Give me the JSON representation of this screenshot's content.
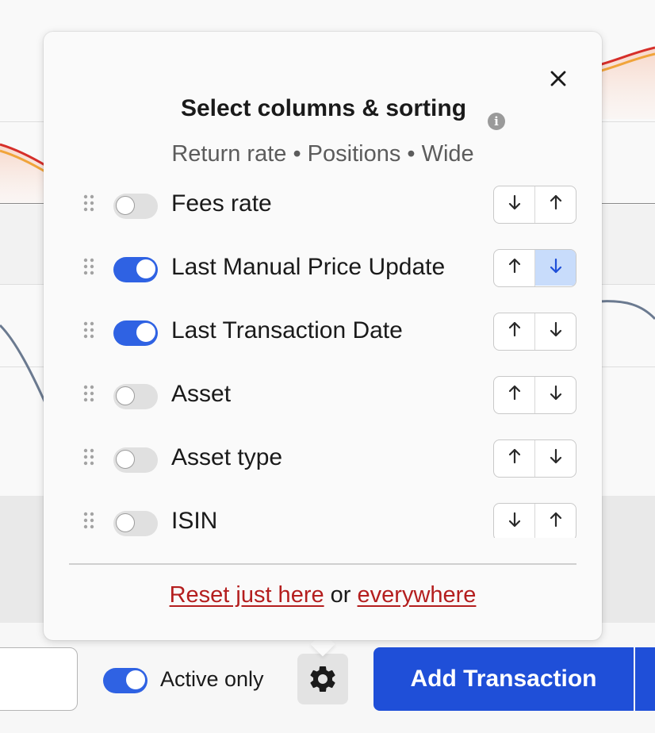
{
  "popover": {
    "title": "Select columns & sorting",
    "subtitle": "Return rate • Positions • Wide",
    "close_icon": "close-icon",
    "info_icon": "info-icon",
    "columns": [
      {
        "label": "Fees rate",
        "enabled": false,
        "sort_left": "↓",
        "sort_right": "↑",
        "active_sort": null
      },
      {
        "label": "Last Manual Price Update",
        "enabled": true,
        "sort_left": "↑",
        "sort_right": "↓",
        "active_sort": "right"
      },
      {
        "label": "Last Transaction Date",
        "enabled": true,
        "sort_left": "↑",
        "sort_right": "↓",
        "active_sort": null
      },
      {
        "label": "Asset",
        "enabled": false,
        "sort_left": "↑",
        "sort_right": "↓",
        "active_sort": null
      },
      {
        "label": "Asset type",
        "enabled": false,
        "sort_left": "↑",
        "sort_right": "↓",
        "active_sort": null
      },
      {
        "label": "ISIN",
        "enabled": false,
        "sort_left": "↓",
        "sort_right": "↑",
        "active_sort": null
      }
    ],
    "reset": {
      "here_label": "Reset just here",
      "or_text": "or",
      "everywhere_label": "everywhere"
    }
  },
  "toolbar": {
    "active_only_label": "Active only",
    "active_only": true,
    "settings_icon": "gear-icon",
    "add_transaction_label": "Add Transaction"
  },
  "colors": {
    "accent": "#1f4fd8",
    "toggle_on": "#2f62e3",
    "reset_link": "#b41e1e",
    "active_sort_bg": "#c8dcfb"
  }
}
